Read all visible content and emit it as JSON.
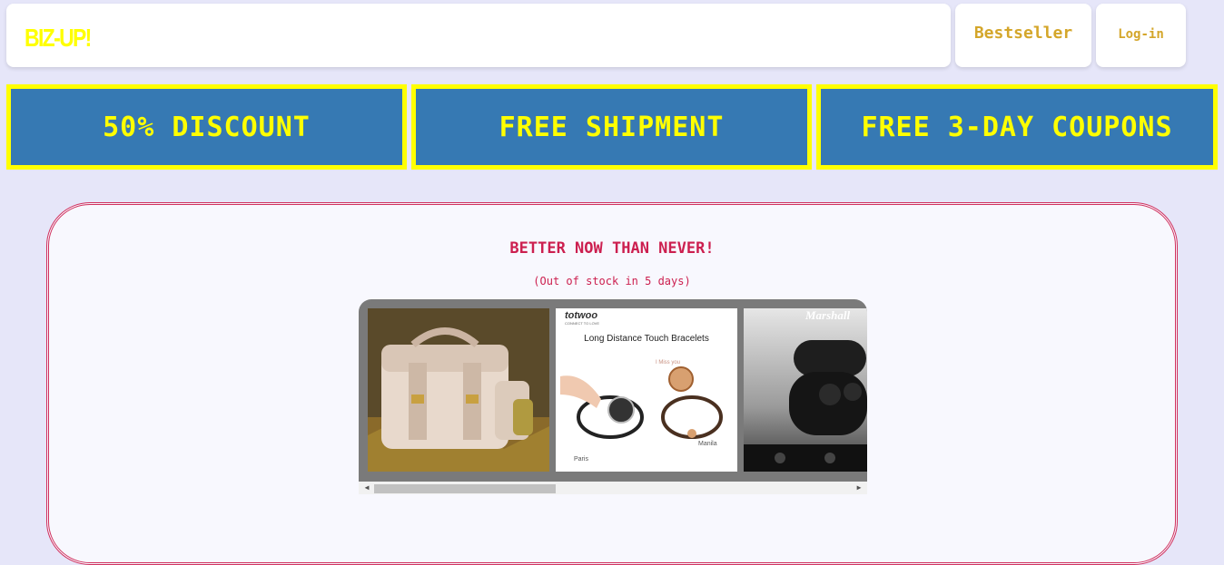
{
  "header": {
    "logo": "BIZ-UP!",
    "nav": {
      "bestseller": "Bestseller",
      "login": "Log-in"
    }
  },
  "banners": [
    "50% DISCOUNT",
    "FREE SHIPMENT",
    "FREE 3-DAY COUPONS"
  ],
  "promo": {
    "title": "BETTER NOW THAN NEVER!",
    "subtitle": "(Out of stock in 5 days)",
    "products": [
      {
        "name": "leather bag photo"
      },
      {
        "brand": "totwoo",
        "tagline": "CONNECT TO LOVE",
        "headline": "Long Distance Touch Bracelets",
        "note": "I Miss you",
        "city_left": "Paris",
        "city_right": "Manila"
      },
      {
        "brand": "Marshall"
      }
    ]
  },
  "colors": {
    "background": "#e6e6f9",
    "accent_yellow": "#ffff00",
    "banner_blue": "#3679b3",
    "nav_gold": "#d4a62a",
    "promo_red": "#cc1f4f"
  }
}
